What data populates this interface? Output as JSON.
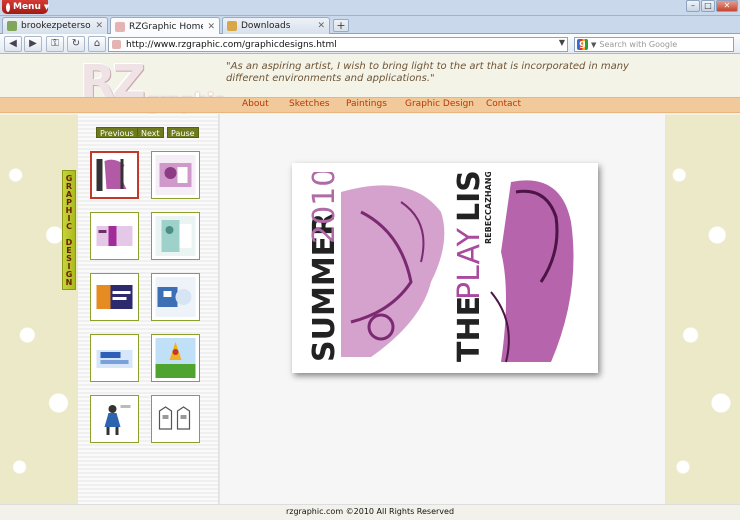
{
  "browser": {
    "menu_label": "Menu",
    "tabs": [
      {
        "label": "brookezpeterson",
        "active": false
      },
      {
        "label": "RZGraphic Home | Reb...",
        "active": true
      },
      {
        "label": "Downloads",
        "active": false
      }
    ],
    "address": "http://www.rzgraphic.com/graphicdesigns.html",
    "search_placeholder": "Search with Google"
  },
  "site": {
    "logo_main": "RZ",
    "logo_sub": "graphic",
    "quote": "\"As an aspiring artist, I wish to bring light to the art that is incorporated in many different environments and applications.\"",
    "nav": [
      "About",
      "Sketches",
      "Paintings",
      "Graphic Design",
      "Contact"
    ],
    "section_label": "GRAPHIC DESIGN",
    "controls": {
      "previous": "Previous",
      "next": "Next",
      "pause": "Pause"
    },
    "poster": {
      "left_title_1": "SUMMER",
      "left_title_2": "2010",
      "right_title_1": "THE",
      "right_title_2": "PLAY",
      "right_title_3": "LIST",
      "right_subtitle": "REBECCAZHANG"
    },
    "footer": "rzgraphic.com ©2010 All Rights Reserved"
  },
  "colors": {
    "nav_bar": "#f2c99a",
    "nav_text": "#b43a08",
    "poster_ink": "#9b3a8f",
    "thumb_border": "#8ca12a",
    "selected_border": "#c0392b"
  }
}
